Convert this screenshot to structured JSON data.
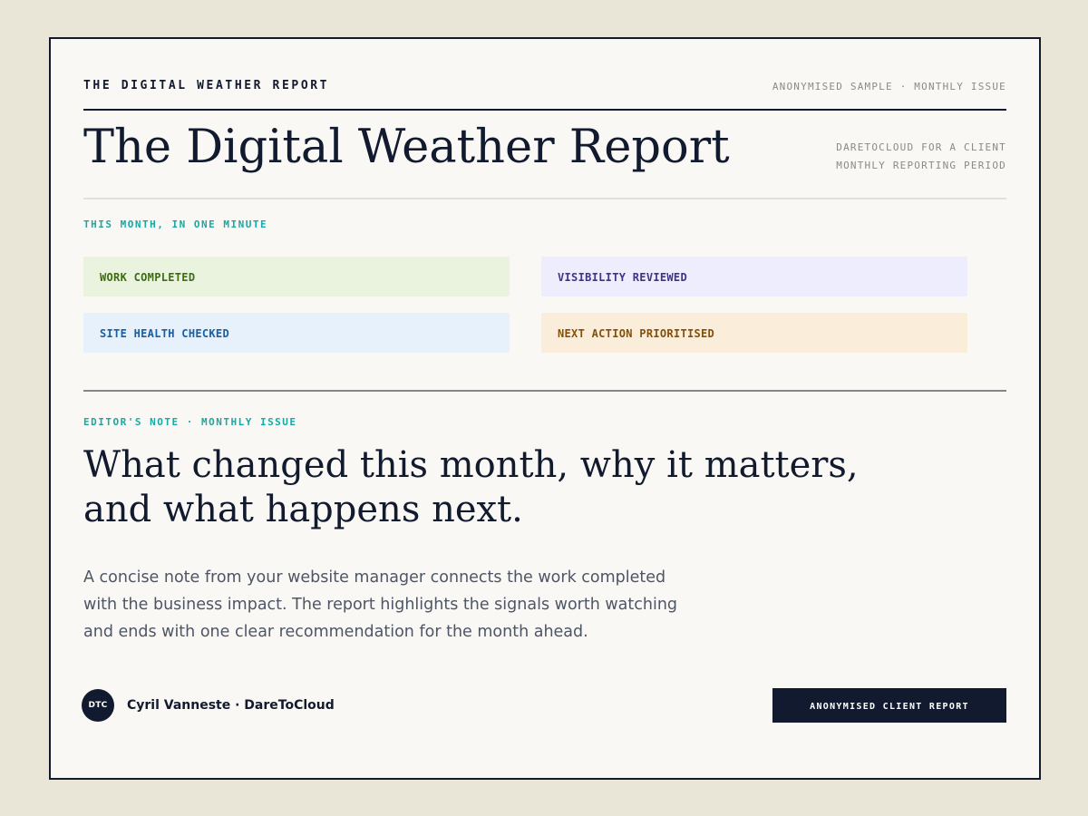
{
  "masthead": {
    "label": "THE DIGITAL WEATHER REPORT",
    "meta": "ANONYMISED SAMPLE · MONTHLY ISSUE"
  },
  "title": "The Digital Weather Report",
  "subtitle": {
    "line1": "DARETOCLOUD FOR A CLIENT",
    "line2": "MONTHLY REPORTING PERIOD"
  },
  "summary": {
    "kicker": "THIS MONTH, IN ONE MINUTE",
    "tiles": [
      {
        "label": "WORK COMPLETED",
        "bg": "#eaf3de",
        "fg": "#3b6d11"
      },
      {
        "label": "VISIBILITY REVIEWED",
        "bg": "#eeedfe",
        "fg": "#3c3489"
      },
      {
        "label": "SITE HEALTH CHECKED",
        "bg": "#e6f1fb",
        "fg": "#185fa5"
      },
      {
        "label": "NEXT ACTION PRIORITISED",
        "bg": "#faeeda",
        "fg": "#854f0b"
      }
    ]
  },
  "editor": {
    "kicker": "EDITOR'S NOTE · MONTHLY ISSUE",
    "headline_line1": "What changed this month, why it matters,",
    "headline_line2": "and what happens next.",
    "body_line1": "A concise note from your website manager connects the work completed",
    "body_line2": "with the business impact. The report highlights the signals worth watching",
    "body_line3": "and ends with one clear recommendation for the month ahead."
  },
  "author": {
    "initials": "DTC",
    "name": "Cyril Vanneste · DareToCloud"
  },
  "badge": "ANONYMISED CLIENT REPORT",
  "colors": {
    "page_bg": "#e9e5d7",
    "card_bg": "#f9f8f4",
    "ink": "#111a2e",
    "accent_teal": "#1aa8a4",
    "muted": "#8a8a88"
  }
}
